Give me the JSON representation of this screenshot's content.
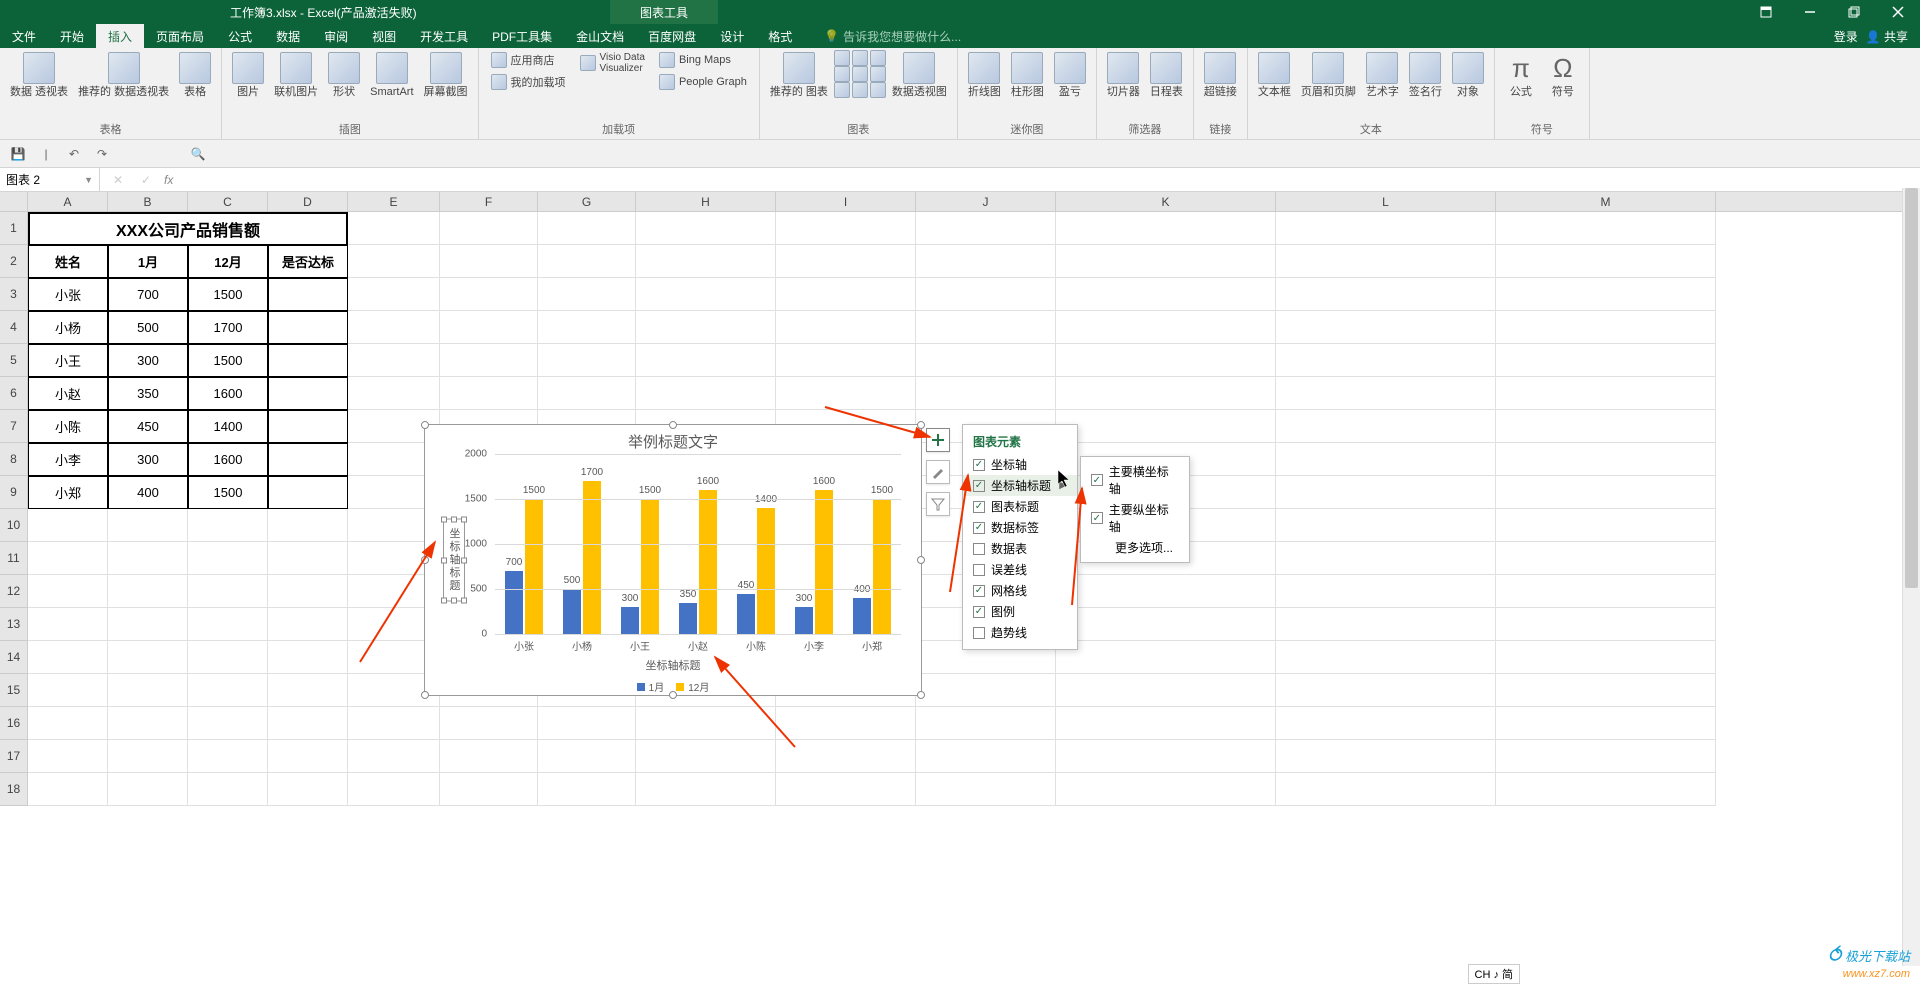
{
  "title_bar": {
    "filename": "工作簿3.xlsx - Excel(产品激活失败)",
    "contextual_tab_group": "图表工具"
  },
  "tabs": {
    "file": "文件",
    "home": "开始",
    "insert": "插入",
    "page_layout": "页面布局",
    "formulas": "公式",
    "data": "数据",
    "review": "审阅",
    "view": "视图",
    "developer": "开发工具",
    "pdf": "PDF工具集",
    "jinshan": "金山文档",
    "baidu": "百度网盘",
    "design": "设计",
    "format": "格式",
    "tell_me": "告诉我您想要做什么...",
    "login": "登录",
    "share": "共享"
  },
  "ribbon": {
    "tables_group": "表格",
    "pivot_table": "数据\n透视表",
    "recommended_pivot": "推荐的\n数据透视表",
    "table": "表格",
    "illustrations_group": "插图",
    "pictures": "图片",
    "online_pictures": "联机图片",
    "shapes": "形状",
    "smartart": "SmartArt",
    "screenshot": "屏幕截图",
    "addins_group": "加载项",
    "store": "应用商店",
    "my_addins": "我的加载项",
    "bing_maps": "Bing Maps",
    "visio": "Visio Data\nVisualizer",
    "people_graph": "People Graph",
    "charts_group": "图表",
    "recommended_charts": "推荐的\n图表",
    "pivot_chart": "数据透视图",
    "sparklines_group": "迷你图",
    "line_spark": "折线图",
    "column_spark": "柱形图",
    "winloss_spark": "盈亏",
    "filters_group": "筛选器",
    "slicer": "切片器",
    "timeline": "日程表",
    "links_group": "链接",
    "hyperlink": "超链接",
    "text_group": "文本",
    "textbox": "文本框",
    "header_footer": "页眉和页脚",
    "wordart": "艺术字",
    "signature": "签名行",
    "object": "对象",
    "symbols_group": "符号",
    "equation": "公式",
    "symbol": "符号"
  },
  "name_box": "图表 2",
  "columns": [
    "A",
    "B",
    "C",
    "D",
    "E",
    "F",
    "G",
    "H",
    "I",
    "J",
    "K",
    "L",
    "M"
  ],
  "table": {
    "title": "XXX公司产品销售额",
    "headers": [
      "姓名",
      "1月",
      "12月",
      "是否达标"
    ],
    "rows": [
      {
        "name": "小张",
        "jan": "700",
        "dec": "1500",
        "ok": ""
      },
      {
        "name": "小杨",
        "jan": "500",
        "dec": "1700",
        "ok": ""
      },
      {
        "name": "小王",
        "jan": "300",
        "dec": "1500",
        "ok": ""
      },
      {
        "name": "小赵",
        "jan": "350",
        "dec": "1600",
        "ok": ""
      },
      {
        "name": "小陈",
        "jan": "450",
        "dec": "1400",
        "ok": ""
      },
      {
        "name": "小李",
        "jan": "300",
        "dec": "1600",
        "ok": ""
      },
      {
        "name": "小郑",
        "jan": "400",
        "dec": "1500",
        "ok": ""
      }
    ]
  },
  "chart_data": {
    "type": "bar",
    "title": "举例标题文字",
    "ylabel": "坐标轴标题",
    "xlabel": "坐标轴标题",
    "categories": [
      "小张",
      "小杨",
      "小王",
      "小赵",
      "小陈",
      "小李",
      "小郑"
    ],
    "series": [
      {
        "name": "1月",
        "color": "#4472c4",
        "values": [
          700,
          500,
          300,
          350,
          450,
          300,
          400
        ]
      },
      {
        "name": "12月",
        "color": "#ffc000",
        "values": [
          1500,
          1700,
          1500,
          1600,
          1400,
          1600,
          1500
        ]
      }
    ],
    "ylim": [
      0,
      2000
    ],
    "yticks": [
      0,
      500,
      1000,
      1500,
      2000
    ]
  },
  "chart_elements": {
    "title": "图表元素",
    "items": [
      {
        "label": "坐标轴",
        "checked": true
      },
      {
        "label": "坐标轴标题",
        "checked": true,
        "hover": true
      },
      {
        "label": "图表标题",
        "checked": true
      },
      {
        "label": "数据标签",
        "checked": true
      },
      {
        "label": "数据表",
        "checked": false
      },
      {
        "label": "误差线",
        "checked": false
      },
      {
        "label": "网格线",
        "checked": true
      },
      {
        "label": "图例",
        "checked": true
      },
      {
        "label": "趋势线",
        "checked": false
      }
    ],
    "submenu": [
      {
        "label": "主要横坐标轴",
        "checked": true
      },
      {
        "label": "主要纵坐标轴",
        "checked": true
      },
      {
        "label": "更多选项...",
        "checked": null
      }
    ]
  },
  "ime": "CH ♪ 简",
  "watermark": {
    "line1": "极光下载站",
    "line2": "www.xz7.com"
  }
}
